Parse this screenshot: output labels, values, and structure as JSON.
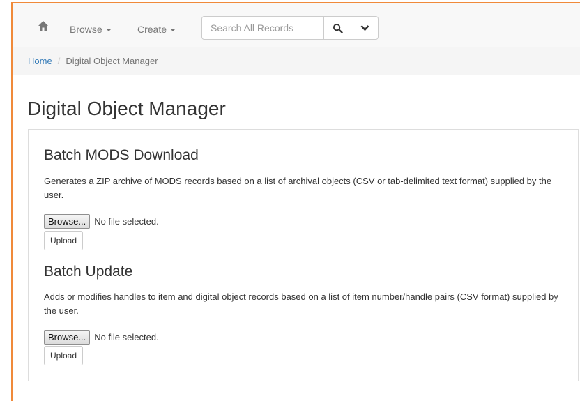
{
  "navbar": {
    "browse_label": "Browse",
    "create_label": "Create",
    "search_placeholder": "Search All Records"
  },
  "breadcrumb": {
    "home": "Home",
    "separator": "/",
    "current": "Digital Object Manager"
  },
  "page": {
    "title": "Digital Object Manager"
  },
  "sections": [
    {
      "title": "Batch MODS Download",
      "description": "Generates a ZIP archive of MODS records based on a list of archival objects (CSV or tab-delimited text format) supplied by the user.",
      "browse_label": "Browse...",
      "file_status": "No file selected.",
      "upload_label": "Upload"
    },
    {
      "title": "Batch Update",
      "description": "Adds or modifies handles to item and digital object records based on a list of item number/handle pairs (CSV format) supplied by the user.",
      "browse_label": "Browse...",
      "file_status": "No file selected.",
      "upload_label": "Upload"
    }
  ],
  "colors": {
    "frame_accent": "#f08a3a",
    "link": "#337ab7",
    "nav_text": "#777777"
  },
  "icons": {
    "home": "home-icon",
    "search": "search-icon",
    "toggle": "chevron-down-icon"
  }
}
